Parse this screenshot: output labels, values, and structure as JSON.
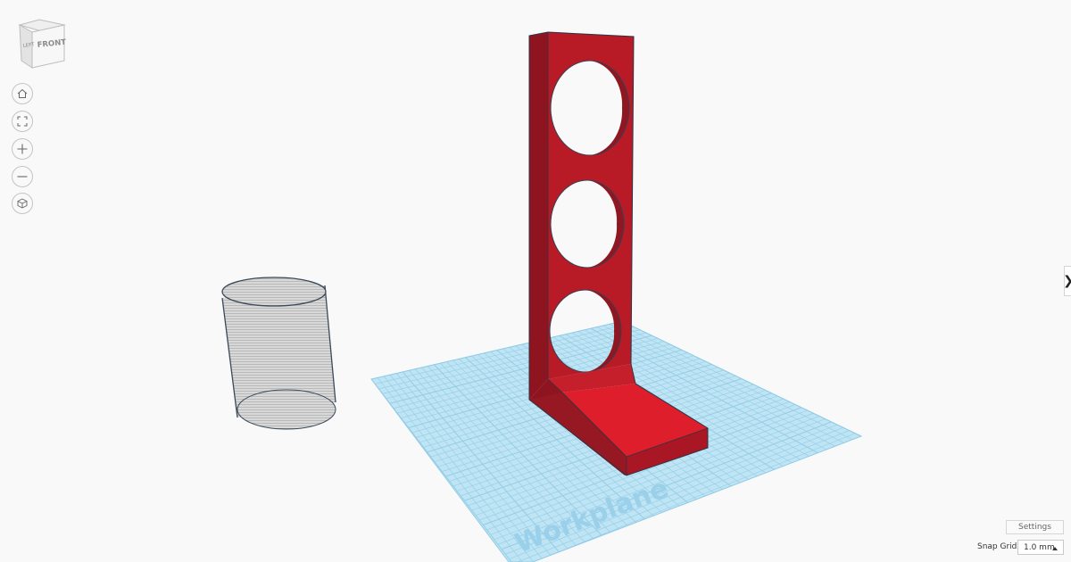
{
  "viewcube": {
    "top_label": "",
    "left_label": "LEFT",
    "front_label": "FRONT"
  },
  "nav": {
    "home_icon": "home-icon",
    "fit_icon": "fit-view-icon",
    "zoom_in_icon": "plus-icon",
    "zoom_out_icon": "minus-icon",
    "ortho_icon": "perspective-cube-icon"
  },
  "workplane": {
    "label": "Workplane",
    "color": "#bfe4f4",
    "grid_color": "#8fcbe6",
    "label_color": "#9bd0ea"
  },
  "shapes": {
    "holder_color": "#d91e2a",
    "hole_shape": "cylinder-hole",
    "solid_shape": "holder-stand"
  },
  "panel_toggle": {
    "glyph": "❯"
  },
  "settings": {
    "label": "Settings"
  },
  "snap_grid": {
    "label": "Snap Grid",
    "value": "1.0 mm"
  }
}
